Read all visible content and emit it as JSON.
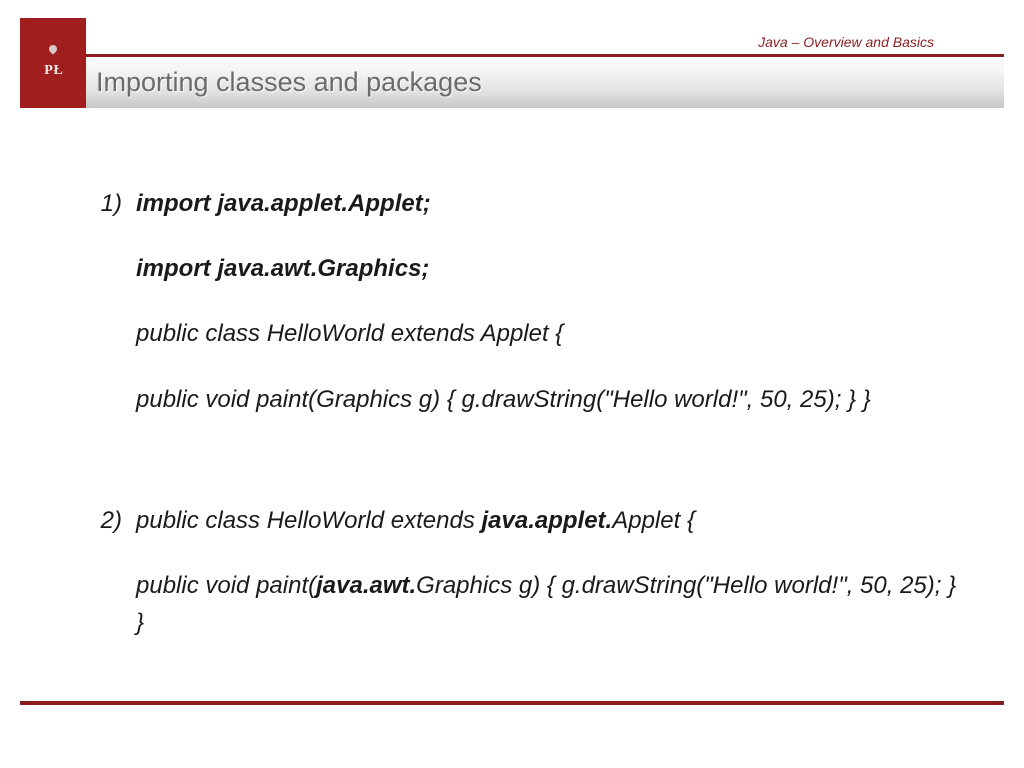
{
  "header": {
    "annotation": "Java – Overview and Basics",
    "title": "Importing classes and packages",
    "logo_letters": "P Ł"
  },
  "items": [
    {
      "marker": "1)",
      "paras": [
        {
          "segments": [
            {
              "t": "import java.applet.Applet;",
              "b": true
            }
          ]
        },
        {
          "segments": [
            {
              "t": "import java.awt.Graphics;",
              "b": true
            }
          ]
        },
        {
          "segments": [
            {
              "t": "public class HelloWorld extends Applet {",
              "b": false
            }
          ]
        },
        {
          "segments": [
            {
              "t": " public void paint(Graphics g) { g.drawString(\"Hello world!\", 50, 25); } }",
              "b": false
            }
          ]
        }
      ]
    },
    {
      "marker": "2)",
      "paras": [
        {
          "segments": [
            {
              "t": "public class HelloWorld extends ",
              "b": false
            },
            {
              "t": "java.applet.",
              "b": true
            },
            {
              "t": "Applet {",
              "b": false
            }
          ]
        },
        {
          "segments": [
            {
              "t": " public void paint(",
              "b": false
            },
            {
              "t": "java.awt.",
              "b": true
            },
            {
              "t": "Graphics g) { g.drawString(\"Hello world!\", 50, 25); } }",
              "b": false
            }
          ]
        }
      ]
    }
  ]
}
